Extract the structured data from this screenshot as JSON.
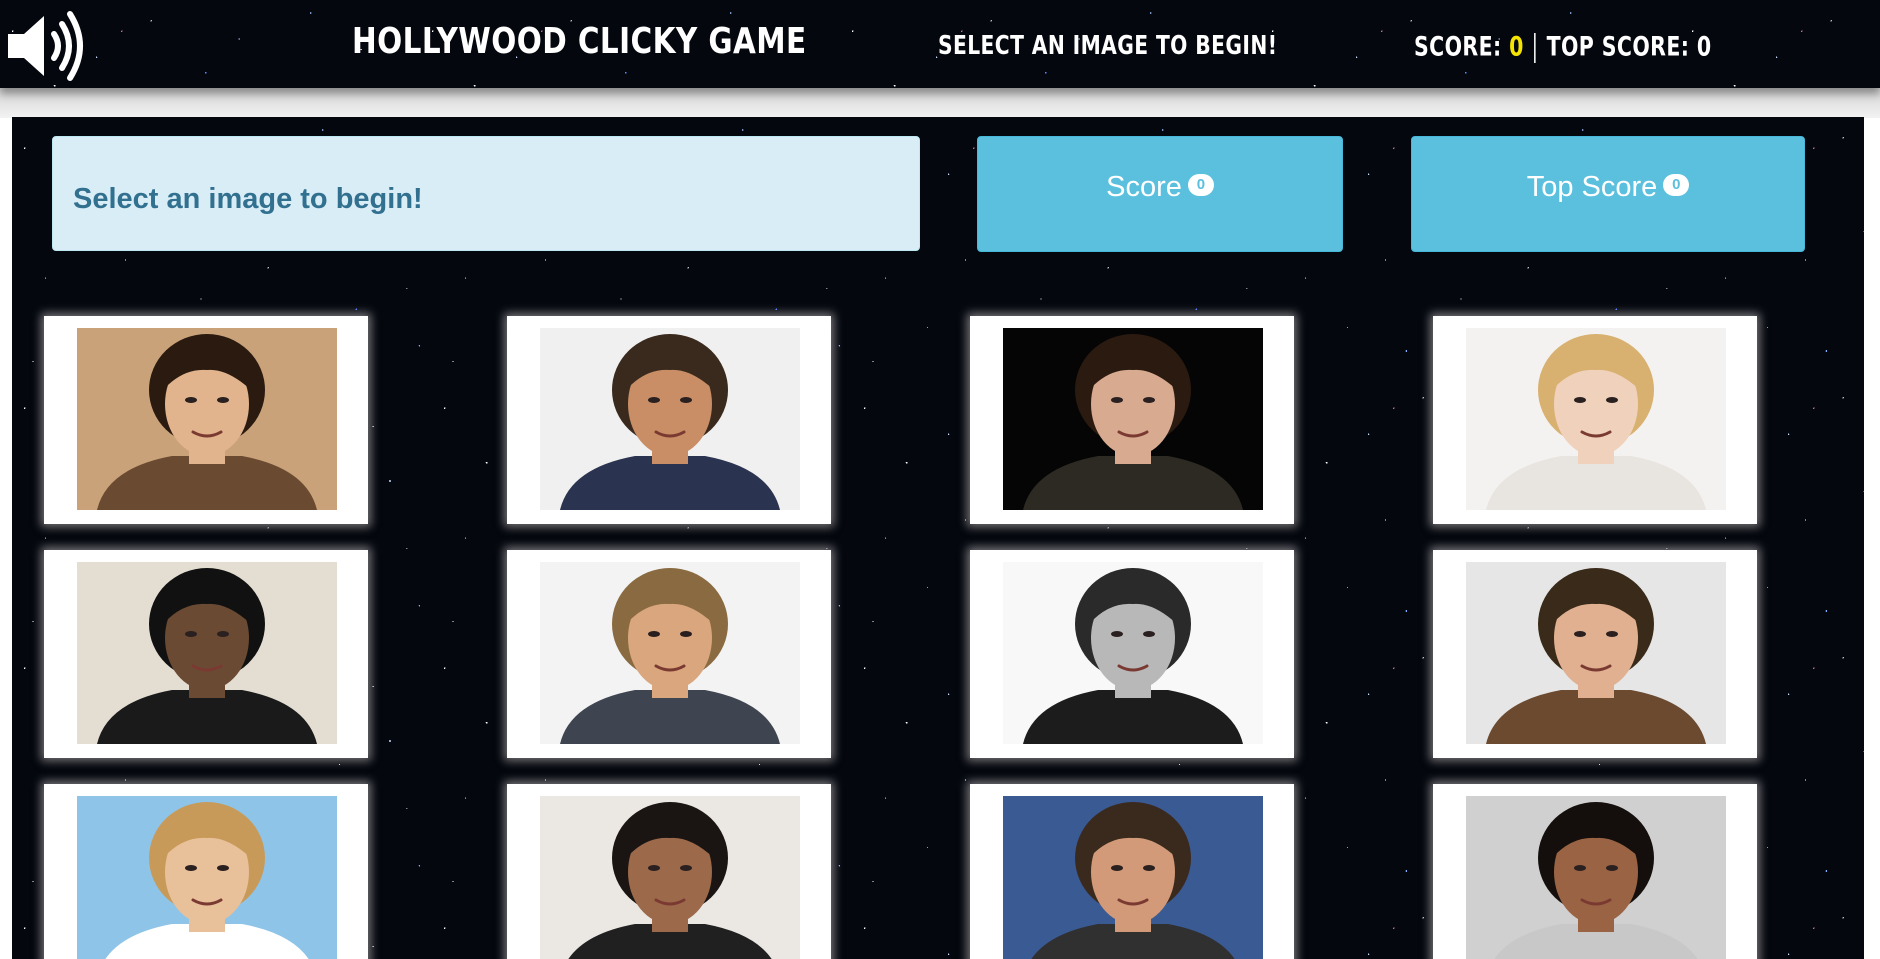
{
  "navbar": {
    "sound_icon": "speaker-volume-icon",
    "title": "Hollywood Clicky Game",
    "message": "Select an image to begin!",
    "score_label": "Score:",
    "score_value": "0",
    "top_score_label": "Top Score:",
    "top_score_value": "0"
  },
  "alert": {
    "text": "Select an image to begin!"
  },
  "buttons": {
    "score": {
      "label": "Score",
      "badge": "0"
    },
    "top_score": {
      "label": "Top Score",
      "badge": "0"
    }
  },
  "colors": {
    "accent": "#5bc0de",
    "alert_bg": "#d9edf7",
    "alert_text": "#31708f",
    "score_highlight": "#f5e400",
    "background": "#05070f"
  },
  "images": [
    {
      "name": "woman-portrait-1",
      "bg": "#c9a27a",
      "hair": "#2a1a10",
      "skin": "#e2b48e",
      "shirt": "#6a4a30"
    },
    {
      "name": "man-portrait-1",
      "bg": "#f0f0f0",
      "hair": "#3a2a1e",
      "skin": "#c98e66",
      "shirt": "#2a3350"
    },
    {
      "name": "man-portrait-2",
      "bg": "#050505",
      "hair": "#2b1a10",
      "skin": "#d8aa90",
      "shirt": "#2c2a22"
    },
    {
      "name": "woman-portrait-2",
      "bg": "#f4f2f0",
      "hair": "#d8b070",
      "skin": "#f0d2bc",
      "shirt": "#e8e4df"
    },
    {
      "name": "man-portrait-3",
      "bg": "#e4ddd2",
      "hair": "#111111",
      "skin": "#6a4a32",
      "shirt": "#1a1a1a"
    },
    {
      "name": "man-portrait-4",
      "bg": "#f3f3f3",
      "hair": "#8a6a40",
      "skin": "#d9a67e",
      "shirt": "#3e4450"
    },
    {
      "name": "man-portrait-5",
      "bg": "#f8f8f8",
      "hair": "#2a2a2a",
      "skin": "#b8b8b8",
      "shirt": "#1c1c1c"
    },
    {
      "name": "man-portrait-6",
      "bg": "#e6e6e6",
      "hair": "#3a2a1a",
      "skin": "#e0b090",
      "shirt": "#6b4a30"
    },
    {
      "name": "woman-portrait-3",
      "bg": "#8ec4e8",
      "hair": "#c89a5a",
      "skin": "#e8c09a",
      "shirt": "#ffffff"
    },
    {
      "name": "man-portrait-7",
      "bg": "#ebe8e4",
      "hair": "#1a1412",
      "skin": "#9c6a4a",
      "shirt": "#202020"
    },
    {
      "name": "man-portrait-8",
      "bg": "#3a5a94",
      "hair": "#3a2a1e",
      "skin": "#d29a78",
      "shirt": "#303030"
    },
    {
      "name": "woman-portrait-4",
      "bg": "#d0d0d0",
      "hair": "#140e0c",
      "skin": "#9a6444",
      "shirt": "#c8c8c8"
    }
  ]
}
